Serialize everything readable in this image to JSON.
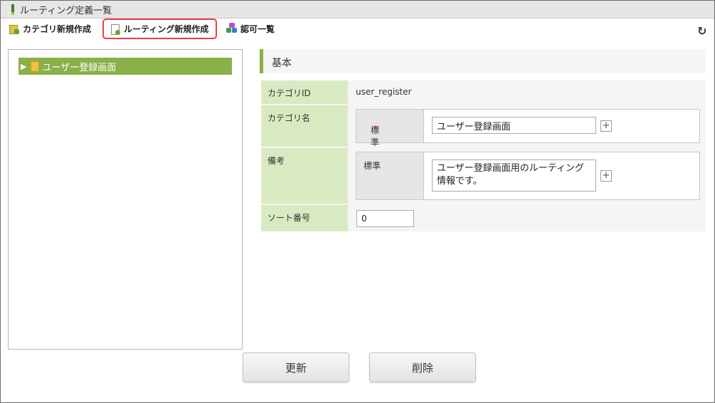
{
  "window": {
    "title": "ルーティング定義一覧"
  },
  "toolbar": {
    "category_new": "カテゴリ新規作成",
    "routing_new": "ルーティング新規作成",
    "authorization_list": "認可一覧",
    "refresh_icon": "refresh-icon",
    "highlight_color": "#e8403e"
  },
  "tree": {
    "items": [
      {
        "label": "ユーザー登録画面",
        "icon": "folder-icon"
      }
    ],
    "selected_color": "#8ab04a"
  },
  "form": {
    "section_title": "基本",
    "category_id": {
      "label": "カテゴリID",
      "value": "user_register"
    },
    "category_name": {
      "label": "カテゴリ名",
      "locale_label": "標準",
      "required_mark": "*",
      "value": "ユーザー登録画面"
    },
    "notes": {
      "label": "備考",
      "locale_label": "標準",
      "value": "ユーザー登録画面用のルーティング情報です。"
    },
    "sort_order": {
      "label": "ソート番号",
      "value": "0"
    }
  },
  "actions": {
    "update": "更新",
    "delete": "削除"
  }
}
